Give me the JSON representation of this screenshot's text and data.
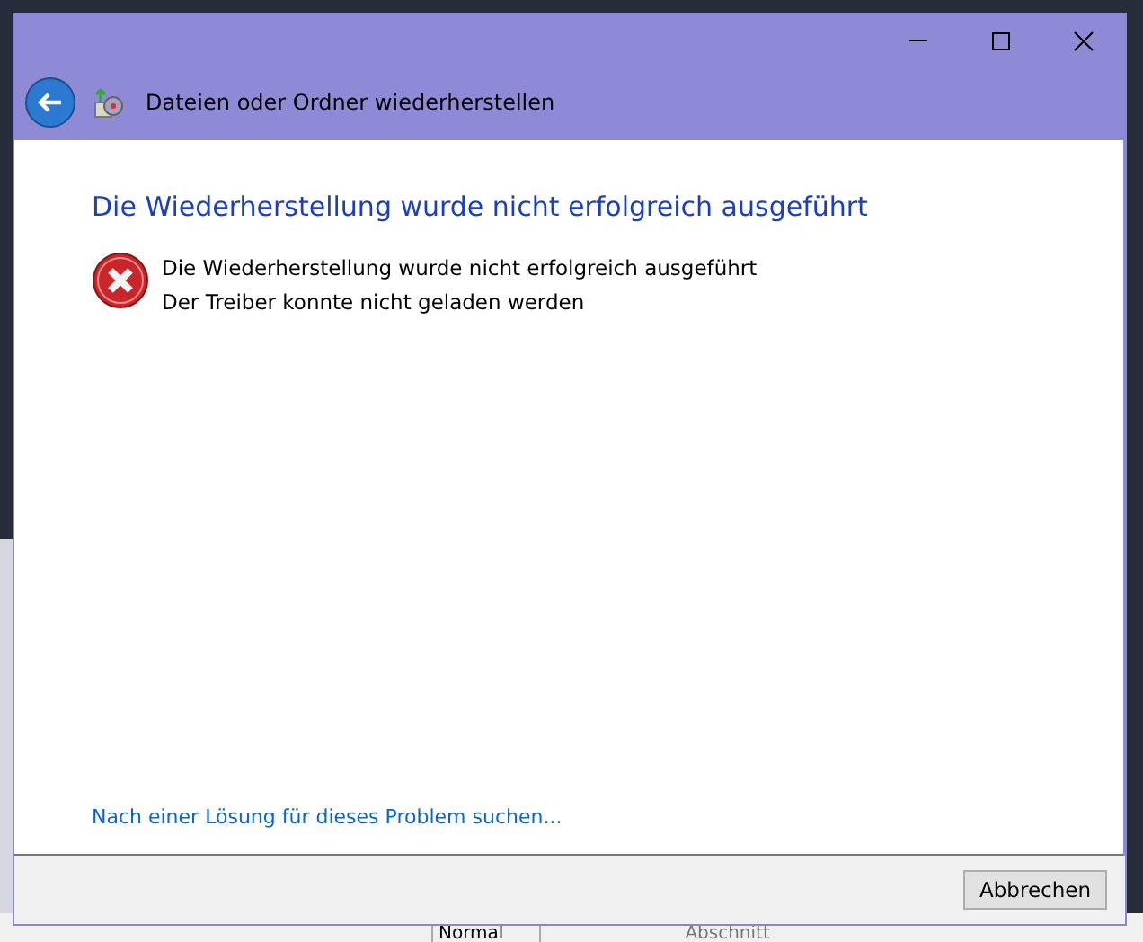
{
  "window": {
    "title": "Dateien oder Ordner wiederherstellen"
  },
  "heading": "Die Wiederherstellung wurde nicht erfolgreich ausgeführt",
  "message": {
    "kind": "error",
    "lines": [
      "Die Wiederherstellung wurde nicht erfolgreich ausgeführt",
      "Der Treiber konnte nicht geladen werden"
    ]
  },
  "help_link": "Nach einer Lösung für dieses Problem suchen...",
  "buttons": [
    "Abbrechen"
  ],
  "background_toolbar": {
    "style": "Normal",
    "section": "Abschnitt"
  }
}
